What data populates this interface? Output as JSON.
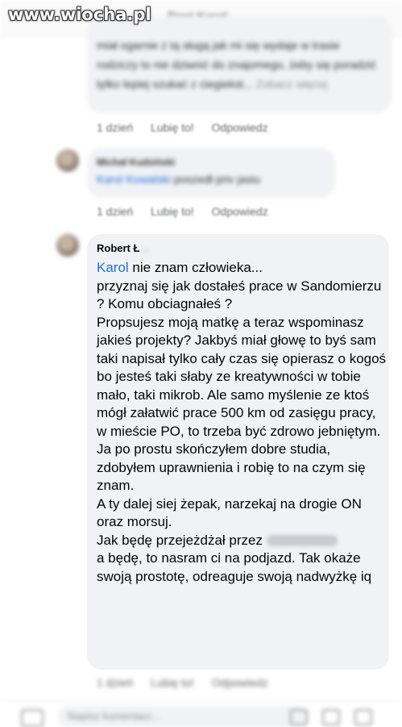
{
  "watermark": "www.wiocha.pl",
  "header": {
    "title": "Post Karol"
  },
  "comments": [
    {
      "text": "miał ogarnie z tą sługą jak mi się wydaje w trasie rodziczy to nie dziwnić do znajomego, żeby się poradzić tylko lepiej szukać z ciegiekst...",
      "more": "Zobacz więcej",
      "time": "1 dzień",
      "like": "Lubię to!",
      "reply": "Odpowiedz"
    },
    {
      "author": "Michał Kudziński",
      "tag": "Karol Kowalski",
      "text": " poszedł priv jasiu",
      "time": "1 dzień",
      "like": "Lubię to!",
      "reply": "Odpowiedz"
    },
    {
      "author": "Robert Ł",
      "author_rest": "...",
      "tag": "Karol",
      "text_a": " nie znam człowieka...\nprzyznaj się jak dostałeś prace w Sandomierzu ? Komu obciagnałeś ?\nPropsujesz moją matkę a teraz wspominasz jakieś projekty? Jakbyś miał głowę to byś sam taki napisał tylko cały czas się opierasz o kogoś bo jesteś taki słaby ze kreatywności w tobie mało, taki mikrob. Ale samo myślenie ze ktoś mógł załatwić prace 500 km od zasięgu pracy, w mieście PO, to trzeba być zdrowo jebniętym.\nJa po prostu skończyłem dobre studia, zdobyłem uprawnienia i robię to na czym się znam.\nA ty dalej siej żepak, narzekaj na drogie ON oraz morsuj.\nJak będę przejeżdżał przez ",
      "text_b": "\na będę, to nasram ci na podjazd. Tak okaże swoją prostotę, odreaguje swoją nadwyżkę iq",
      "time": "1 dzień",
      "like": "Lubię to!",
      "reply": "Odpowiedz"
    }
  ],
  "composer": {
    "placeholder": "Napisz komentarz..."
  }
}
